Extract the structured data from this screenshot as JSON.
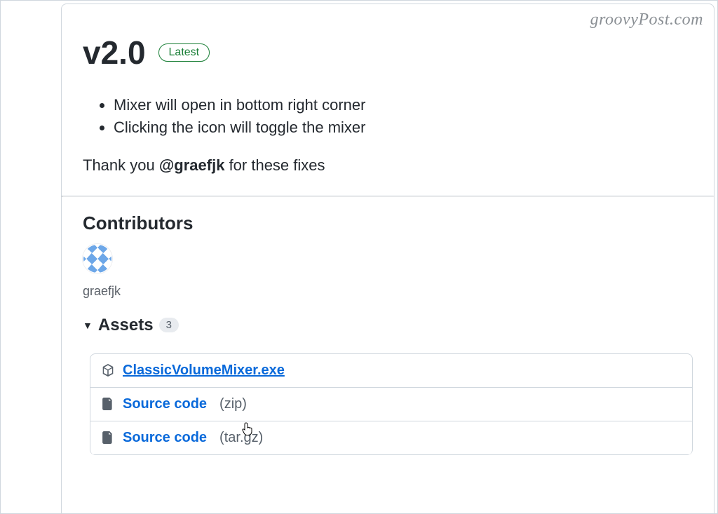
{
  "watermark": "groovyPost.com",
  "release": {
    "version_title": "v2.0",
    "latest_label": "Latest",
    "notes": [
      "Mixer will open in bottom right corner",
      "Clicking the icon will toggle the mixer"
    ],
    "thanks_prefix": "Thank you ",
    "thanks_mention": "@graefjk",
    "thanks_suffix": " for these fixes"
  },
  "contributors": {
    "heading": "Contributors",
    "list": [
      {
        "name": "graefjk"
      }
    ]
  },
  "assets": {
    "heading": "Assets",
    "count": "3",
    "items": [
      {
        "name": "ClassicVolumeMixer.exe",
        "suffix": "",
        "underline": true,
        "icon": "package"
      },
      {
        "name": "Source code",
        "suffix": "(zip)",
        "underline": false,
        "icon": "zip"
      },
      {
        "name": "Source code",
        "suffix": "(tar.gz)",
        "underline": false,
        "icon": "zip"
      }
    ]
  }
}
